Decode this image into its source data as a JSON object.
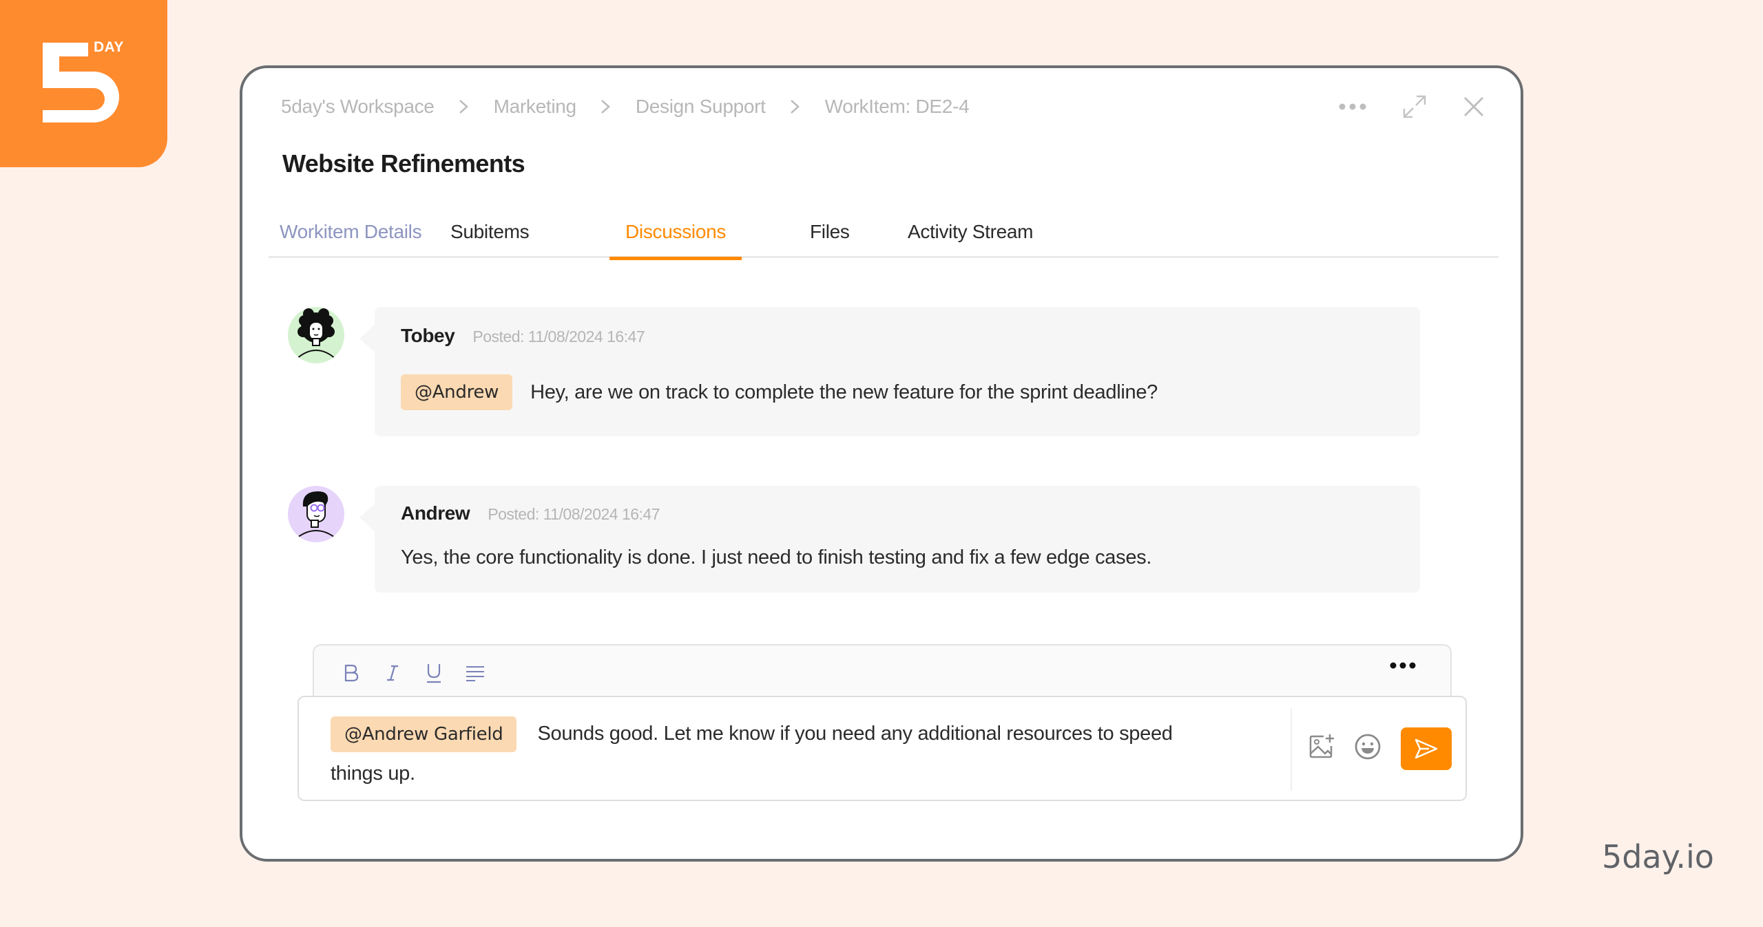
{
  "brand": {
    "logo_text": "DAY",
    "logo_numeral": "5",
    "url": "5day.io",
    "accent_color": "#ff8a00"
  },
  "breadcrumb": [
    {
      "label": "5day's Workspace"
    },
    {
      "label": "Marketing"
    },
    {
      "label": "Design Support"
    },
    {
      "label": "WorkItem: DE2-4"
    }
  ],
  "window_actions": {
    "more": "more-icon",
    "expand": "expand-icon",
    "close": "close-icon"
  },
  "page": {
    "title": "Website Refinements"
  },
  "tabs": [
    {
      "label": "Workitem Details",
      "state": "muted"
    },
    {
      "label": "Subitems",
      "state": "normal"
    },
    {
      "label": "Discussions",
      "state": "active"
    },
    {
      "label": "Files",
      "state": "normal"
    },
    {
      "label": "Activity Stream",
      "state": "normal"
    }
  ],
  "messages": [
    {
      "author": "Tobey",
      "posted": "Posted: 11/08/2024 16:47",
      "mention": "@Andrew",
      "text": "Hey, are we on track to complete the new feature for the sprint deadline?",
      "avatar_bg": "#d4f2cf"
    },
    {
      "author": "Andrew",
      "posted": "Posted: 11/08/2024 16:47",
      "mention": "",
      "text": "Yes, the core functionality is done. I just need to finish testing and fix a few edge cases.",
      "avatar_bg": "#e6d4fb"
    }
  ],
  "editor": {
    "toolbar": [
      {
        "icon": "bold-icon",
        "label": "B"
      },
      {
        "icon": "italic-icon",
        "label": "I"
      },
      {
        "icon": "underline-icon",
        "label": "U"
      },
      {
        "icon": "align-left-icon",
        "label": ""
      }
    ],
    "mention": "@Andrew Garfield",
    "text": "Sounds good. Let me know if you need any additional resources to speed things up.",
    "actions": {
      "add_image": "add-image-icon",
      "emoji": "emoji-icon",
      "send": "send-icon"
    }
  }
}
